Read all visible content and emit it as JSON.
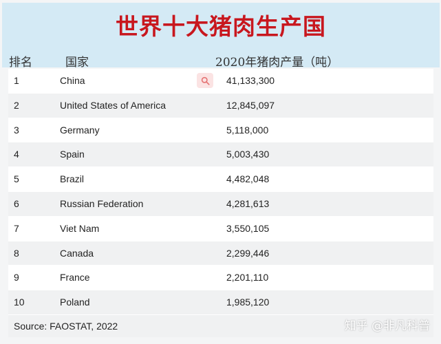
{
  "title": "世界十大猪肉生产国",
  "columns": {
    "rank": "排名",
    "country": "国家",
    "value": "2020年猪肉产量（吨）"
  },
  "rows": [
    {
      "rank": "1",
      "country": "China",
      "value": "41,133,300"
    },
    {
      "rank": "2",
      "country": "United States of America",
      "value": "12,845,097"
    },
    {
      "rank": "3",
      "country": "Germany",
      "value": "5,118,000"
    },
    {
      "rank": "4",
      "country": "Spain",
      "value": "5,003,430"
    },
    {
      "rank": "5",
      "country": "Brazil",
      "value": "4,482,048"
    },
    {
      "rank": "6",
      "country": "Russian Federation",
      "value": "4,281,613"
    },
    {
      "rank": "7",
      "country": "Viet Nam",
      "value": "3,550,105"
    },
    {
      "rank": "8",
      "country": "Canada",
      "value": "2,299,446"
    },
    {
      "rank": "9",
      "country": "France",
      "value": "2,201,110"
    },
    {
      "rank": "10",
      "country": "Poland",
      "value": "1,985,120"
    }
  ],
  "source": "Source: FAOSTAT, 2022",
  "watermark": "知乎 @非凡科普",
  "colors": {
    "title": "#c8171e",
    "header_bg": "#d4eaf5"
  },
  "icons": {
    "search": "search-icon"
  }
}
